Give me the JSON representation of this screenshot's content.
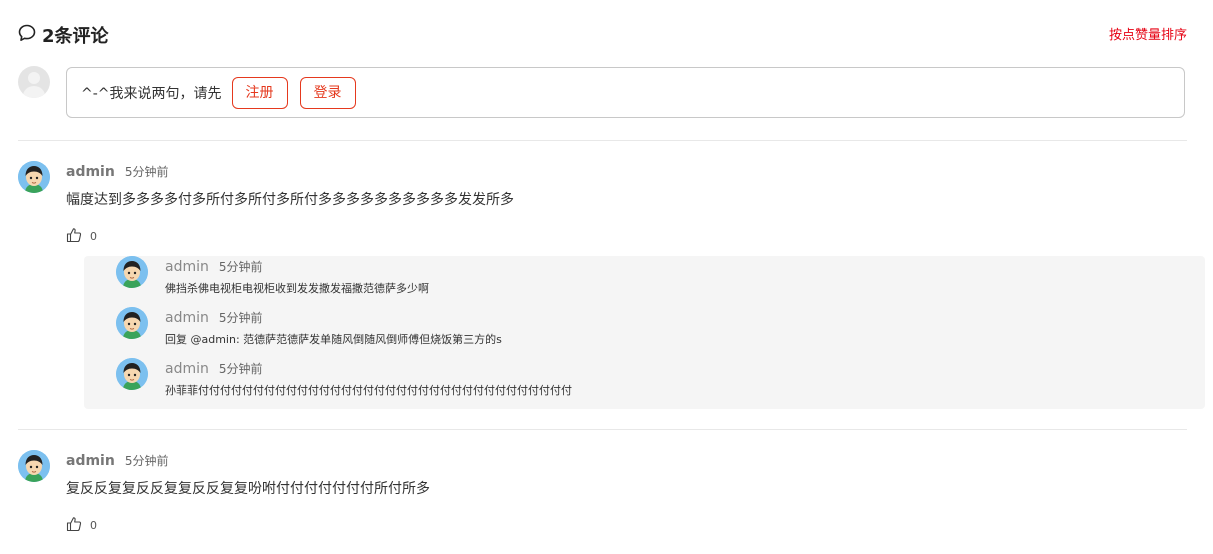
{
  "header": {
    "count_title": "2条评论",
    "sort_label": "按点赞量排序"
  },
  "composer": {
    "prompt": "^-^我来说两句，请先",
    "register_label": "注册",
    "login_label": "登录"
  },
  "comments": [
    {
      "author": "admin",
      "time": "5分钟前",
      "text": "幅度达到多多多多付多所付多所付多所付多多多多多多多多多多发发所多",
      "likes": "0",
      "replies": [
        {
          "author": "admin",
          "time": "5分钟前",
          "text": "佛挡杀佛电视柜电视柜收到发发撒发福撒范德萨多少啊"
        },
        {
          "author": "admin",
          "time": "5分钟前",
          "text": "回复 @admin: 范德萨范德萨发单随风倒随风倒师傅但烧饭第三方的s"
        },
        {
          "author": "admin",
          "time": "5分钟前",
          "text": "孙菲菲付付付付付付付付付付付付付付付付付付付付付付付付付付付付付付付付付付"
        }
      ]
    },
    {
      "author": "admin",
      "time": "5分钟前",
      "text": "复反反复复反反复复反反复复吩咐付付付付付付付所付所多",
      "likes": "0",
      "replies": []
    }
  ],
  "colors": {
    "accent_red": "#e60012",
    "button_red": "#e5391e",
    "reply_bg": "#f5f5f5"
  }
}
